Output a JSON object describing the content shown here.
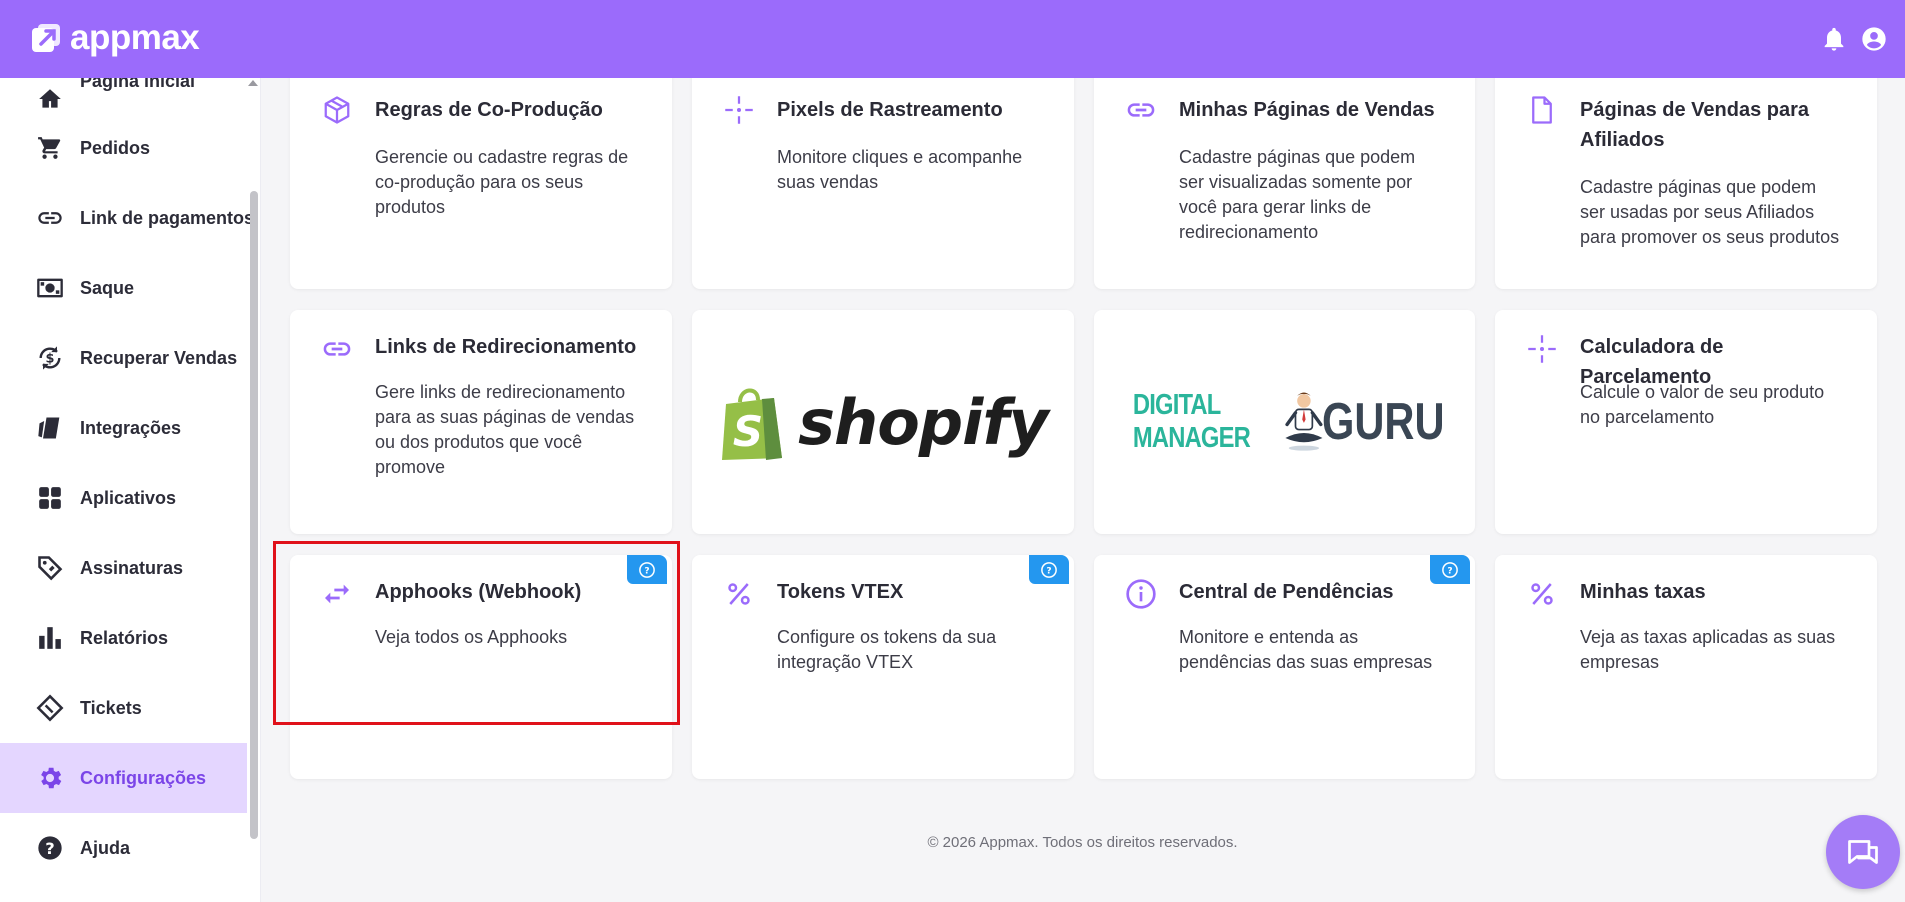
{
  "header": {
    "logo_text": "appmax",
    "icons": [
      "bell-icon",
      "account-icon"
    ]
  },
  "sidebar": {
    "items": [
      {
        "label": "Página inicial",
        "icon": "home-icon"
      },
      {
        "label": "Pedidos",
        "icon": "cart-icon"
      },
      {
        "label": "Link de pagamentos",
        "icon": "link-icon"
      },
      {
        "label": "Saque",
        "icon": "money-icon"
      },
      {
        "label": "Recuperar Vendas",
        "icon": "recover-icon"
      },
      {
        "label": "Integrações",
        "icon": "integration-icon"
      },
      {
        "label": "Aplicativos",
        "icon": "apps-icon"
      },
      {
        "label": "Assinaturas",
        "icon": "tag-icon"
      },
      {
        "label": "Relatórios",
        "icon": "chart-icon"
      },
      {
        "label": "Tickets",
        "icon": "ticket-icon"
      },
      {
        "label": "Configurações",
        "icon": "gear-icon",
        "active": true
      },
      {
        "label": "Ajuda",
        "icon": "help-icon"
      }
    ]
  },
  "cards": {
    "co_producao": {
      "title": "Regras de Co-Produção",
      "desc": "Gerencie ou cadastre regras de co-produção para os seus produtos",
      "icon": "box-icon"
    },
    "pixels": {
      "title": "Pixels de Rastreamento",
      "desc": "Monitore cliques e acompanhe suas vendas",
      "icon": "crosshair-icon"
    },
    "paginas_vendas": {
      "title": "Minhas Páginas de Vendas",
      "desc": "Cadastre páginas que podem ser visualizadas somente por você para gerar links de redirecionamento",
      "icon": "link-icon"
    },
    "paginas_afiliados": {
      "title": "Páginas de Vendas para Afiliados",
      "desc": "Cadastre páginas que podem ser usadas por seus Afiliados para promover os seus produtos",
      "icon": "file-icon"
    },
    "links_redirecionamento": {
      "title": "Links de Redirecionamento",
      "desc": "Gere links de redirecionamento para as suas páginas de vendas ou dos produtos que você promove",
      "icon": "link-icon"
    },
    "shopify": {
      "logo_text": "shopify",
      "icon": "shopify-bag-icon"
    },
    "guru": {
      "logo_text_left": "DIGITAL MANAGER",
      "logo_text_right": "GURU",
      "icon": "guru-person-icon"
    },
    "calculadora": {
      "title": "Calculadora de Parcelamento",
      "desc": "Calcule o valor de seu produto no parcelamento",
      "icon": "crosshair-icon"
    },
    "apphooks": {
      "title": "Apphooks (Webhook)",
      "desc": "Veja todos os Apphooks",
      "icon": "swap-arrows-icon",
      "help": "help-circle-icon"
    },
    "tokens_vtex": {
      "title": "Tokens VTEX",
      "desc": "Configure os tokens da sua integração VTEX",
      "icon": "percent-icon",
      "help": "help-circle-icon"
    },
    "central_pendencias": {
      "title": "Central de Pendências",
      "desc": "Monitore e entenda as pendências das suas empresas",
      "icon": "info-icon",
      "help": "help-circle-icon"
    },
    "minhas_taxas": {
      "title": "Minhas taxas",
      "desc": "Veja as taxas aplicadas as suas empresas",
      "icon": "percent-icon"
    }
  },
  "colors": {
    "brand": "#9b6bfb",
    "accent_icon": "#9b6bfb",
    "help_badge": "#2497ef",
    "highlight": "#e0111a"
  },
  "footer": {
    "text": "© 2026 Appmax. Todos os direitos reservados."
  },
  "chat": {
    "icon": "chat-icon"
  }
}
